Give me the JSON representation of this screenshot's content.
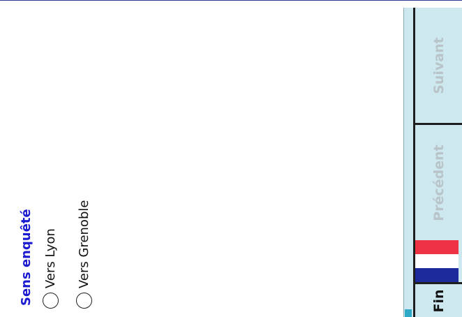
{
  "question": {
    "title": "Sens enquêté",
    "options": [
      {
        "label": "Vers Lyon",
        "selected": false
      },
      {
        "label": "Vers Grenoble",
        "selected": false
      }
    ]
  },
  "nav": {
    "next_label": "Suivant",
    "prev_label": "Précédent",
    "end_label": "Fin",
    "language_flag": "france-flag-icon"
  },
  "colors": {
    "title": "#1a1ad0",
    "panel": "#cde8ef",
    "disabled_text": "#b8c4c8"
  }
}
